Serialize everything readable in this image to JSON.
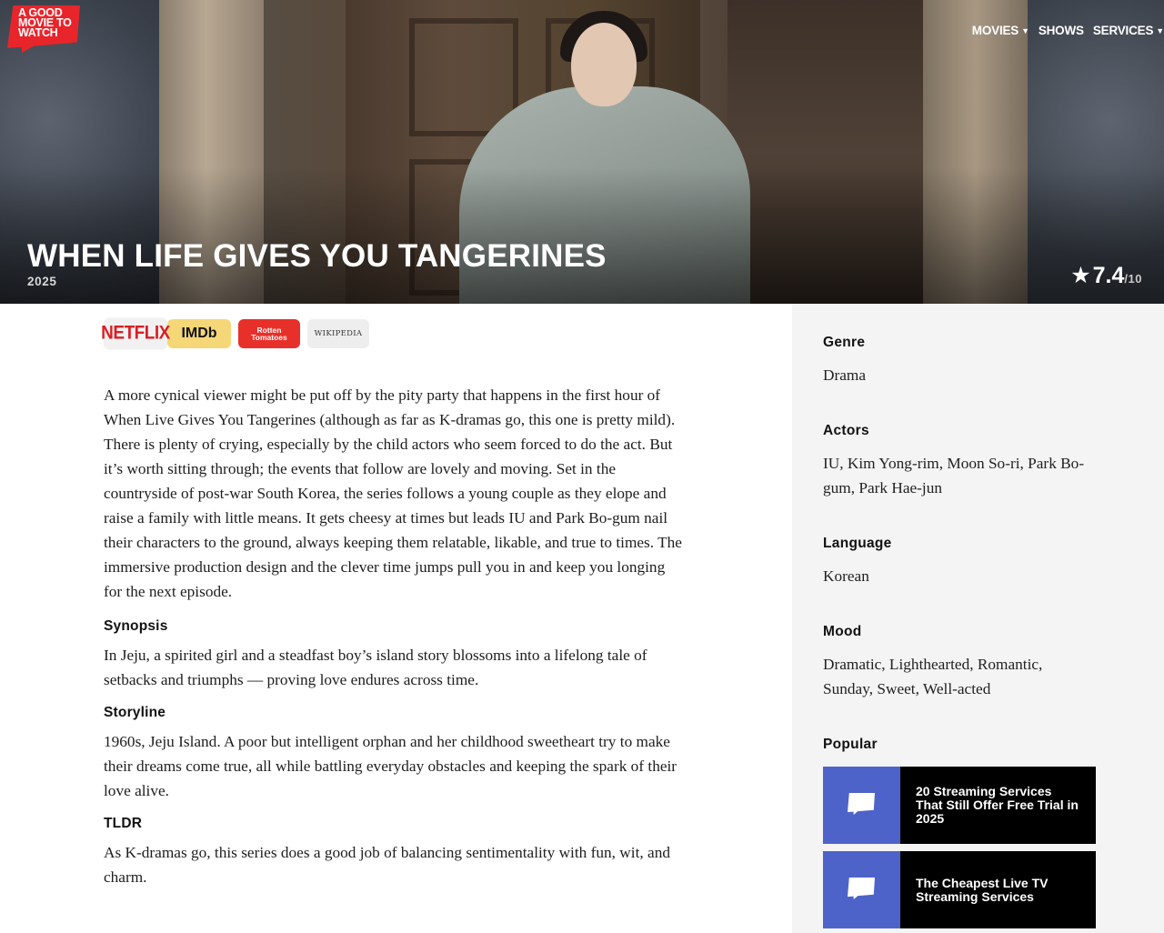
{
  "brand": {
    "logo_lines": [
      "A GOOD",
      "MOVIE TO",
      "WATCH"
    ]
  },
  "nav": {
    "items": [
      {
        "label": "MOVIES",
        "has_dropdown": true
      },
      {
        "label": "SHOWS",
        "has_dropdown": false
      },
      {
        "label": "SERVICES",
        "has_dropdown": true
      }
    ]
  },
  "hero": {
    "title": "WHEN LIFE GIVES YOU TANGERINES",
    "year": "2025",
    "rating": {
      "star": "★",
      "score": "7.4",
      "out_of": "/10"
    }
  },
  "sources": {
    "netflix": "NETFLIX",
    "imdb": "IMDb",
    "rotten_tomatoes_lines": [
      "Rotten",
      "Tomatoes"
    ],
    "wikipedia": "WIKIPEDIA"
  },
  "review": "A more cynical viewer might be put off by the pity party that happens in the first hour of When Live Gives You Tangerines (although as far as K-dramas go, this one is pretty mild). There is plenty of crying, especially by the child actors who seem forced to do the act. But it’s worth sitting through; the events that follow are lovely and moving. Set in the countryside of post-war South Korea, the series follows a young couple as they elope and raise a family with little means. It gets cheesy at times but leads IU and Park Bo-gum nail their characters to the ground, always keeping them relatable, likable, and true to times. The immersive production design and the clever time jumps pull you in and keep you longing for the next episode.",
  "sections": {
    "synopsis": {
      "heading": "Synopsis",
      "text": "In Jeju, a spirited girl and a steadfast boy’s island story blossoms into a lifelong tale of setbacks and triumphs — proving love endures across time."
    },
    "storyline": {
      "heading": "Storyline",
      "text": "1960s, Jeju Island. A poor but intelligent orphan and her childhood sweetheart try to make their dreams come true, all while battling everyday obstacles and keeping the spark of their love alive."
    },
    "tldr": {
      "heading": "TLDR",
      "text": "As K-dramas go, this series does a good job of balancing sentimentality with fun, wit, and charm."
    }
  },
  "sidebar": {
    "genre": {
      "heading": "Genre",
      "value": "Drama"
    },
    "actors": {
      "heading": "Actors",
      "value": "IU, Kim Yong-rim, Moon So-ri, Park Bo-gum, Park Hae-jun"
    },
    "language": {
      "heading": "Language",
      "value": "Korean"
    },
    "mood": {
      "heading": "Mood",
      "value": "Dramatic, Lighthearted, Romantic, Sunday, Sweet, Well-acted"
    },
    "popular": {
      "heading": "Popular",
      "items": [
        {
          "title": "20 Streaming Services That Still Offer Free Trial in 2025"
        },
        {
          "title": "The Cheapest Live TV Streaming Services"
        }
      ]
    }
  },
  "colors": {
    "brand_red": "#e8252b",
    "imdb_yellow": "#f6d778",
    "rt_red": "#e8302a",
    "netflix_red": "#d81f26",
    "popular_thumb": "#4e63c9",
    "sidebar_bg": "#f4f4f4"
  },
  "icons": {
    "rating": "star-icon",
    "dropdown": "caret-down-icon"
  }
}
